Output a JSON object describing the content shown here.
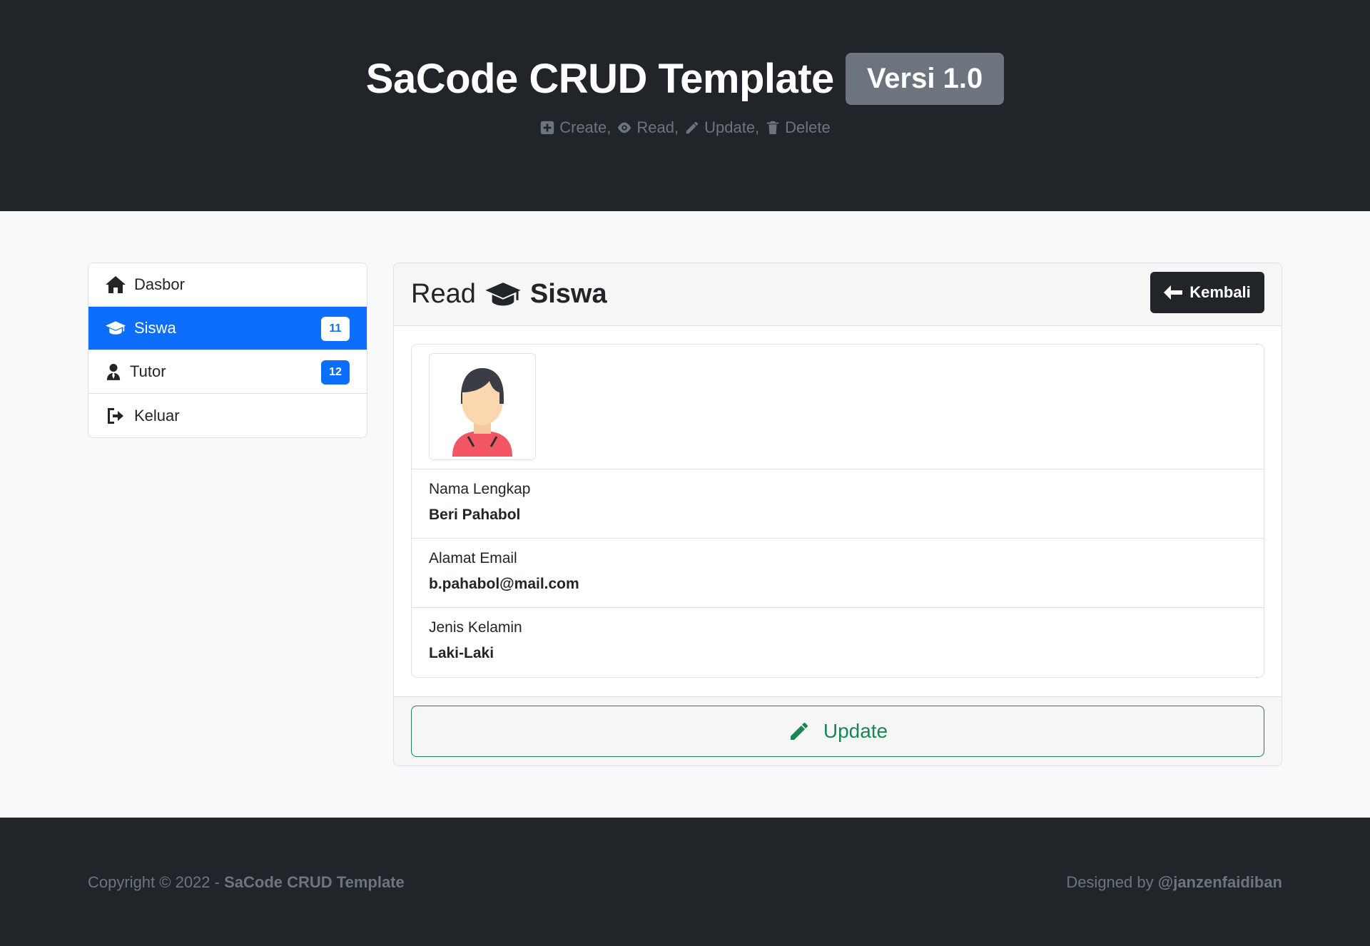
{
  "header": {
    "title": "SaCode CRUD Template",
    "version": "Versi 1.0",
    "ops": [
      {
        "icon": "plus-square-icon",
        "label": "Create,"
      },
      {
        "icon": "eye-icon",
        "label": "Read,"
      },
      {
        "icon": "pencil-icon",
        "label": "Update,"
      },
      {
        "icon": "trash-icon",
        "label": "Delete"
      }
    ]
  },
  "sidebar": {
    "items": [
      {
        "icon": "home-icon",
        "label": "Dasbor",
        "active": false
      },
      {
        "icon": "graduation-cap-icon",
        "label": "Siswa",
        "badge": "11",
        "active": true
      },
      {
        "icon": "user-tie-icon",
        "label": "Tutor",
        "badge": "12",
        "active": false
      },
      {
        "icon": "sign-out-icon",
        "label": "Keluar",
        "active": false
      }
    ]
  },
  "card": {
    "title_prefix": "Read",
    "title_icon": "graduation-cap-icon",
    "title_main": "Siswa",
    "back_label": "Kembali",
    "avatar_icon": "student-avatar-icon",
    "fields": [
      {
        "label": "Nama Lengkap",
        "value": "Beri Pahabol"
      },
      {
        "label": "Alamat Email",
        "value": "b.pahabol@mail.com"
      },
      {
        "label": "Jenis Kelamin",
        "value": "Laki-Laki"
      }
    ],
    "update_label": "Update"
  },
  "footer": {
    "copyright_prefix": "Copyright © 2022 -",
    "copyright_brand": "SaCode CRUD Template",
    "designed_prefix": "Designed by",
    "designed_author": "@janzenfaidiban"
  },
  "colors": {
    "dark": "#212529",
    "primary": "#0d6efd",
    "success": "#198754",
    "muted": "#6c757d"
  }
}
